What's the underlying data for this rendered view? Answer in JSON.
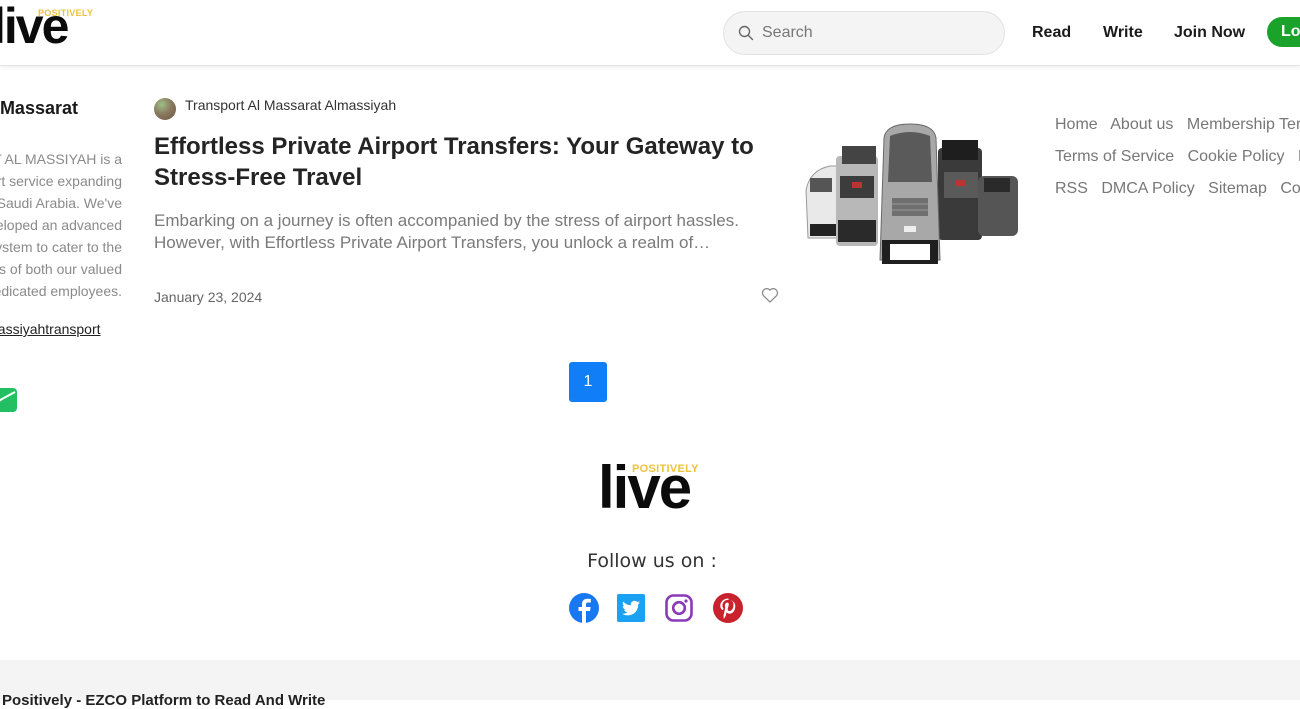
{
  "header": {
    "logo": {
      "word": "live",
      "tagline": "POSITIVELY"
    },
    "search": {
      "placeholder": "Search",
      "value": ""
    },
    "nav": [
      {
        "label": "Read"
      },
      {
        "label": "Write"
      },
      {
        "label": "Join Now"
      }
    ],
    "login_label": "Log in"
  },
  "sidebar": {
    "title": "Transport Al Massarat",
    "description_lines": [
      "TRANSPORT AL MASSIYAH is a",
      "transport service expanding",
      "across Saudi Arabia. We've",
      "developed an advanced",
      "management system to cater to the",
      "needs of both our valued",
      "clients and dedicated employees."
    ],
    "link": "transportalmassiyahtransport",
    "mail_icon": "envelope-icon"
  },
  "article": {
    "author": "Transport Al Massarat Almassiyah",
    "title": "Effortless Private Airport Transfers: Your Gateway to Stress-Free Travel",
    "excerpt": "Embarking on a journey is often accompanied by the stress of airport hassles. However, with Effortless Private Airport Transfers, you unlock a realm of…",
    "date": "January 23, 2024",
    "image_alt": "Fleet of vans and SUVs"
  },
  "footer_links": [
    [
      "Home",
      "About us",
      "Membership Terms"
    ],
    [
      "Terms of Service",
      "Cookie Policy",
      "Privacy Policy"
    ],
    [
      "RSS",
      "DMCA Policy",
      "Sitemap",
      "Contact"
    ]
  ],
  "pagination": {
    "current": "1"
  },
  "footer": {
    "logo": {
      "word": "live",
      "tagline": "POSITIVELY"
    },
    "follow_label": "Follow us on :",
    "social": [
      "facebook",
      "twitter",
      "instagram",
      "pinterest"
    ],
    "bottom_text": "Positively - EZCO Platform to Read And Write"
  },
  "colors": {
    "brand_yellow": "#f0c23a",
    "login_green": "#1aa22a",
    "page_blue": "#0f7ef7",
    "facebook": "#1877f2",
    "twitter": "#1da1f2",
    "instagram": "#8a3ab9",
    "pinterest": "#c8232c"
  }
}
